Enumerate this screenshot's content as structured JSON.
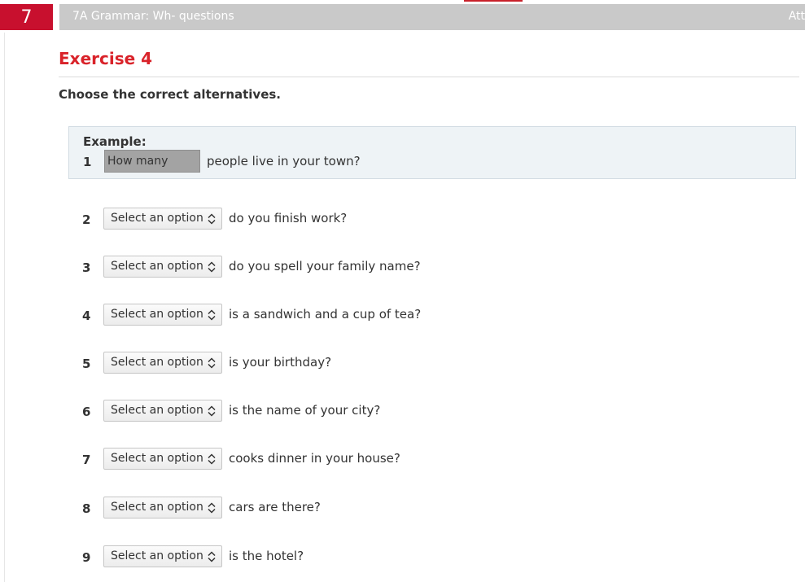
{
  "header": {
    "unit_number": "7",
    "title": "7A Grammar: Wh- questions",
    "right_text": "Att"
  },
  "exercise": {
    "title": "Exercise 4",
    "instructions": "Choose the correct alternatives."
  },
  "example": {
    "label": "Example:",
    "number": "1",
    "answer": "How many",
    "text": "people live in your town?"
  },
  "select_placeholder": "Select an option",
  "questions": [
    {
      "number": "2",
      "select_value": "Select an option",
      "text": "do you finish work?"
    },
    {
      "number": "3",
      "select_value": "Select an option",
      "text": "do you spell your family name?"
    },
    {
      "number": "4",
      "select_value": "Select an option",
      "text": "is a sandwich and a cup of tea?"
    },
    {
      "number": "5",
      "select_value": "Select an option",
      "text": "is your birthday?"
    },
    {
      "number": "6",
      "select_value": "Select an option",
      "text": "is the name of your city?"
    },
    {
      "number": "7",
      "select_value": "Select an option",
      "text": "cooks dinner in your house?"
    },
    {
      "number": "8",
      "select_value": "Select an option",
      "text": "cars are there?"
    },
    {
      "number": "9",
      "select_value": "Select an option",
      "text": "is the hotel?"
    }
  ],
  "colors": {
    "accent_red": "#c8102e",
    "title_red": "#d9232a",
    "header_gray": "#c9c9c9",
    "example_bg": "#eef3f6"
  }
}
